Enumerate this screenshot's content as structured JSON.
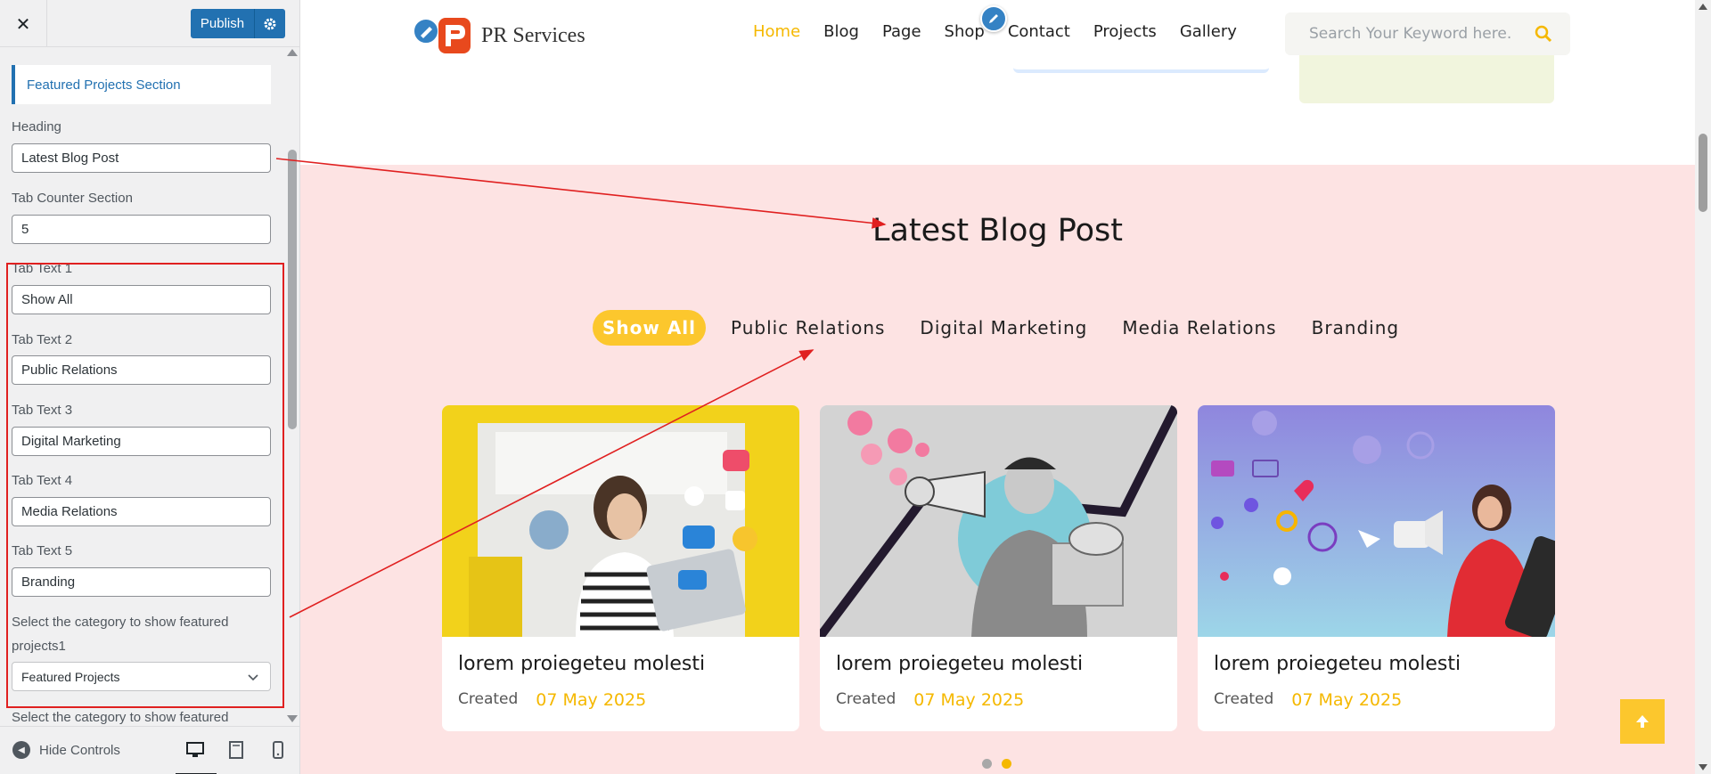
{
  "customizer": {
    "close_icon": "close-icon",
    "publish_label": "Publish",
    "section_title": "Featured Projects Section",
    "controls": [
      {
        "label": "Heading",
        "value": "Latest Blog Post"
      },
      {
        "label": "Tab Counter Section",
        "value": "5"
      },
      {
        "label": "Tab Text 1",
        "value": "Show All"
      },
      {
        "label": "Tab Text 2",
        "value": "Public Relations"
      },
      {
        "label": "Tab Text 3",
        "value": "Digital Marketing"
      },
      {
        "label": "Tab Text 4",
        "value": "Media Relations"
      },
      {
        "label": "Tab Text 5",
        "value": "Branding"
      }
    ],
    "category_label_1": "Select the category to show featured projects1",
    "category_select_value": "Featured Projects",
    "category_label_2": "Select the category to show featured",
    "hide_controls_label": "Hide Controls",
    "devices": [
      "desktop-icon",
      "tablet-icon",
      "mobile-icon"
    ]
  },
  "site": {
    "logo_text": "PR Services",
    "nav": [
      {
        "label": "Home",
        "active": true
      },
      {
        "label": "Blog",
        "active": false
      },
      {
        "label": "Page",
        "active": false
      },
      {
        "label": "Shop",
        "active": false
      },
      {
        "label": "Contact",
        "active": false
      },
      {
        "label": "Projects",
        "active": false
      },
      {
        "label": "Gallery",
        "active": false
      }
    ],
    "search_placeholder": "Search Your Keyword here.",
    "blog_heading": "Latest Blog Post",
    "tabs": [
      "Show All",
      "Public Relations",
      "Digital Marketing",
      "Media Relations",
      "Branding"
    ],
    "cards": [
      {
        "title": "lorem proiegeteu molesti",
        "created": "Created",
        "date": "07 May 2025"
      },
      {
        "title": "lorem proiegeteu molesti",
        "created": "Created",
        "date": "07 May 2025"
      },
      {
        "title": "lorem proiegeteu molesti",
        "created": "Created",
        "date": "07 May 2025"
      }
    ],
    "to_top_icon": "arrow-up-icon"
  },
  "colors": {
    "accent": "#fcc72d",
    "wp_blue": "#2271b1",
    "section_bg": "#fde3e3",
    "annotation_red": "#e02020"
  }
}
